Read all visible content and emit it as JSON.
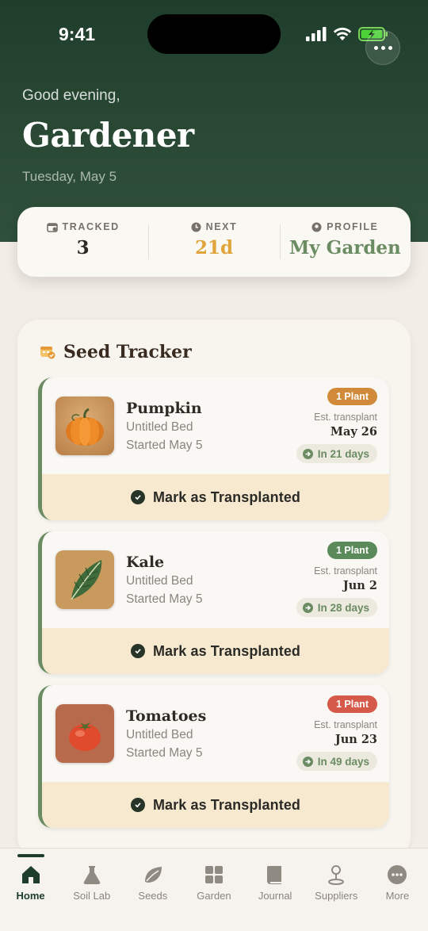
{
  "status": {
    "time": "9:41"
  },
  "header": {
    "greeting": "Good evening,",
    "title": "Gardener",
    "date": "Tuesday, May 5"
  },
  "stats": [
    {
      "label": "TRACKED",
      "value": "3",
      "icon": "calendar-icon",
      "color": "#2c2a26"
    },
    {
      "label": "NEXT",
      "value": "21d",
      "icon": "clock-icon",
      "color": "#e0a43a"
    },
    {
      "label": "PROFILE",
      "value": "My Garden",
      "icon": "profile-icon",
      "color": "#6b8c62"
    }
  ],
  "tracker": {
    "title": "Seed Tracker",
    "icon": "seed-tracker-icon",
    "action_label": "Mark as Transplanted",
    "est_label": "Est. transplant",
    "cards": [
      {
        "name": "Pumpkin",
        "bed": "Untitled Bed",
        "started": "Started May 5",
        "badge": "1 Plant",
        "badge_color": "#d08a3a",
        "est_date": "May 26",
        "days": "In 21 days",
        "thumb": "pumpkin-image"
      },
      {
        "name": "Kale",
        "bed": "Untitled Bed",
        "started": "Started May 5",
        "badge": "1 Plant",
        "badge_color": "#5b8a5a",
        "est_date": "Jun 2",
        "days": "In 28 days",
        "thumb": "kale-image"
      },
      {
        "name": "Tomatoes",
        "bed": "Untitled Bed",
        "started": "Started May 5",
        "badge": "1 Plant",
        "badge_color": "#d55a4a",
        "est_date": "Jun 23",
        "days": "In 49 days",
        "thumb": "tomato-image"
      }
    ]
  },
  "tabs": [
    {
      "label": "Home",
      "icon": "home-icon",
      "active": true
    },
    {
      "label": "Soil Lab",
      "icon": "flask-icon",
      "active": false
    },
    {
      "label": "Seeds",
      "icon": "leaf-icon",
      "active": false
    },
    {
      "label": "Garden",
      "icon": "grid-icon",
      "active": false
    },
    {
      "label": "Journal",
      "icon": "book-icon",
      "active": false
    },
    {
      "label": "Suppliers",
      "icon": "map-pin-icon",
      "active": false
    },
    {
      "label": "More",
      "icon": "more-icon",
      "active": false
    }
  ]
}
